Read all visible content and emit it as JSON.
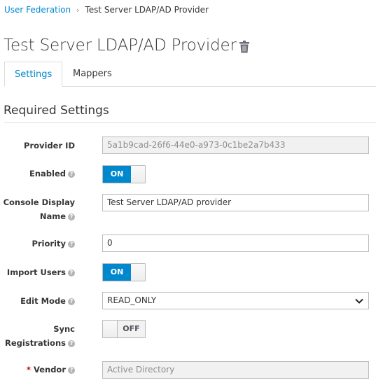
{
  "breadcrumb": {
    "parent": "User Federation",
    "separator": "›",
    "current": "Test Server LDAP/AD Provider"
  },
  "header": {
    "title": "Test Server LDAP/AD Provider",
    "delete_icon": "trash-icon"
  },
  "tabs": [
    {
      "label": "Settings",
      "active": true
    },
    {
      "label": "Mappers",
      "active": false
    }
  ],
  "section": {
    "title": "Required Settings"
  },
  "help_icon": "?",
  "accent_color": "#0088ce",
  "fields": {
    "provider_id": {
      "label": "Provider ID",
      "value": "5a1b9cad-26f6-44e0-a973-0c1be2a7b433"
    },
    "enabled": {
      "label": "Enabled",
      "state": "ON"
    },
    "console_display_name": {
      "label_line1": "Console Display",
      "label_line2": "Name",
      "value": "Test Server LDAP/AD provider"
    },
    "priority": {
      "label": "Priority",
      "value": "0"
    },
    "import_users": {
      "label": "Import Users",
      "state": "ON"
    },
    "edit_mode": {
      "label": "Edit Mode",
      "value": "READ_ONLY"
    },
    "sync_registrations": {
      "label_line1": "Sync",
      "label_line2": "Registrations",
      "state": "OFF"
    },
    "vendor": {
      "required_mark": "*",
      "label": "Vendor",
      "value": "Active Directory"
    }
  }
}
